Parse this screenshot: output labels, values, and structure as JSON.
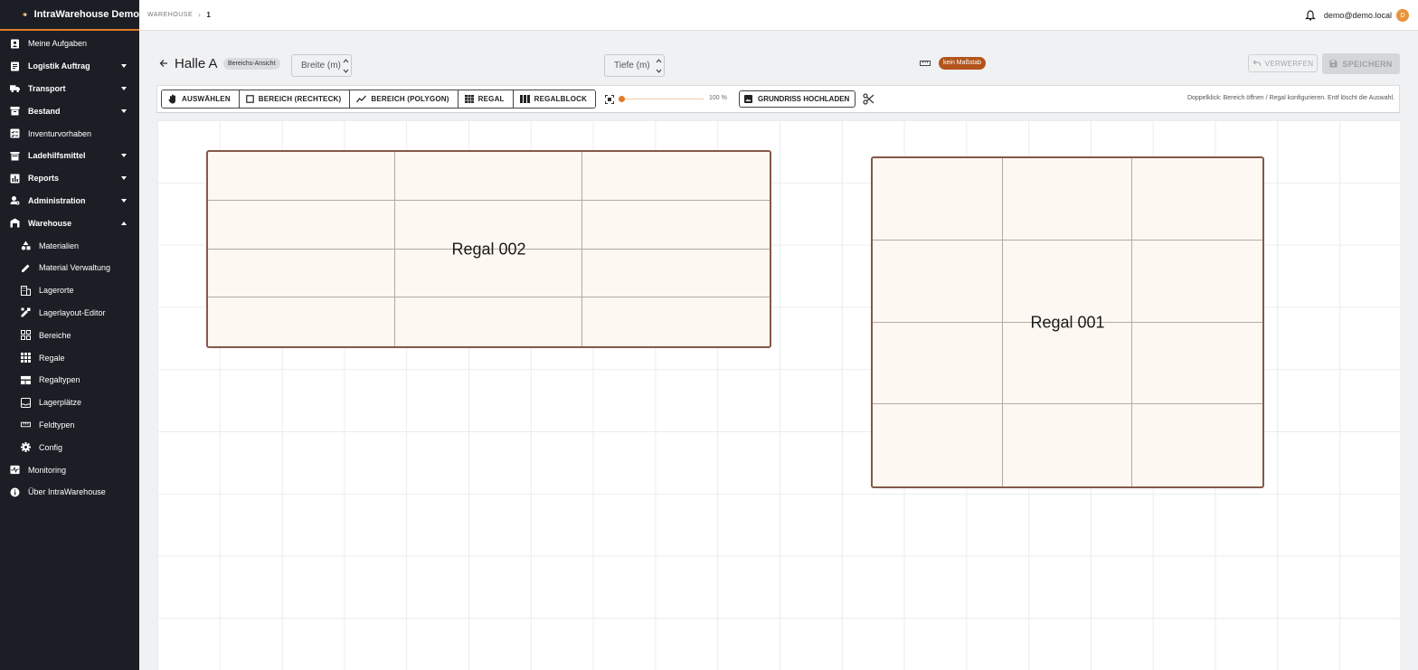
{
  "app": {
    "title": "IntraWarehouse Demo"
  },
  "sidebar": {
    "items": [
      {
        "label": "Meine Aufgaben",
        "icon": "assignment-ind-icon",
        "bold": false,
        "caret": ""
      },
      {
        "label": "Logistik Auftrag",
        "icon": "assignment-icon",
        "bold": true,
        "caret": "down"
      },
      {
        "label": "Transport",
        "icon": "truck-icon",
        "bold": true,
        "caret": "down"
      },
      {
        "label": "Bestand",
        "icon": "inventory-box-icon",
        "bold": true,
        "caret": "down"
      },
      {
        "label": "Inventurvorhaben",
        "icon": "checklist-icon",
        "bold": false,
        "caret": ""
      },
      {
        "label": "Ladehilfsmittel",
        "icon": "pallet-icon",
        "bold": true,
        "caret": "down"
      },
      {
        "label": "Reports",
        "icon": "chart-icon",
        "bold": true,
        "caret": "down"
      },
      {
        "label": "Administration",
        "icon": "admin-gear-icon",
        "bold": true,
        "caret": "down"
      },
      {
        "label": "Warehouse",
        "icon": "warehouse-icon",
        "bold": true,
        "caret": "up"
      }
    ],
    "subitems": [
      {
        "label": "Materialien",
        "icon": "shapes-icon"
      },
      {
        "label": "Material Verwaltung",
        "icon": "pencil-icon"
      },
      {
        "label": "Lagerorte",
        "icon": "building-icon"
      },
      {
        "label": "Lagerlayout-Editor",
        "icon": "design-edit-icon"
      },
      {
        "label": "Bereiche",
        "icon": "grid-view-icon"
      },
      {
        "label": "Regale",
        "icon": "apps-grid-icon"
      },
      {
        "label": "Regaltypen",
        "icon": "view-quilt-icon"
      },
      {
        "label": "Lagerplätze",
        "icon": "inbox-icon"
      },
      {
        "label": "Feldtypen",
        "icon": "ruler-icon"
      },
      {
        "label": "Config",
        "icon": "gear-icon"
      }
    ],
    "bottom_items": [
      {
        "label": "Monitoring",
        "icon": "monitoring-icon"
      },
      {
        "label": "Über IntraWarehouse",
        "icon": "info-icon"
      }
    ]
  },
  "topbar": {
    "breadcrumb": {
      "root": "WAREHOUSE",
      "separator": "›",
      "current": "1"
    },
    "user_email": "demo@demo.local",
    "avatar_initial": "D"
  },
  "header": {
    "title": "Halle A",
    "view_chip": "Bereichs-Ansicht",
    "width_placeholder": "Breite (m)",
    "depth_placeholder": "Tiefe (m)",
    "scale_badge": "kein Maßstab",
    "discard_label": "VERWERFEN",
    "save_label": "SPEICHERN"
  },
  "toolbar": {
    "tools": [
      {
        "label": "AUSWÄHLEN",
        "icon": "hand-icon"
      },
      {
        "label": "BEREICH (RECHTECK)",
        "icon": "rectangle-icon"
      },
      {
        "label": "BEREICH (POLYGON)",
        "icon": "polyline-icon"
      },
      {
        "label": "REGAL",
        "icon": "rack-grid-icon"
      },
      {
        "label": "REGALBLOCK",
        "icon": "rack-block-icon"
      }
    ],
    "zoom_value": "100 %",
    "zoom_fraction": 0.0,
    "upload_label": "GRUNDRISS HOCHLADEN",
    "hint": "Doppelklick: Bereich öffnen / Regal konfigurieren. Entf löscht die Auswahl."
  },
  "canvas": {
    "racks": [
      {
        "label": "Regal 002",
        "rows": 4,
        "cols": 3
      },
      {
        "label": "Regal 001",
        "rows": 4,
        "cols": 3
      }
    ]
  },
  "colors": {
    "sidebar_bg": "#1b1f25",
    "accent": "#e07b2a",
    "rack_border": "#85584a",
    "rack_fill": "#fdf8f1",
    "scale_badge_bg": "#b2541c"
  }
}
